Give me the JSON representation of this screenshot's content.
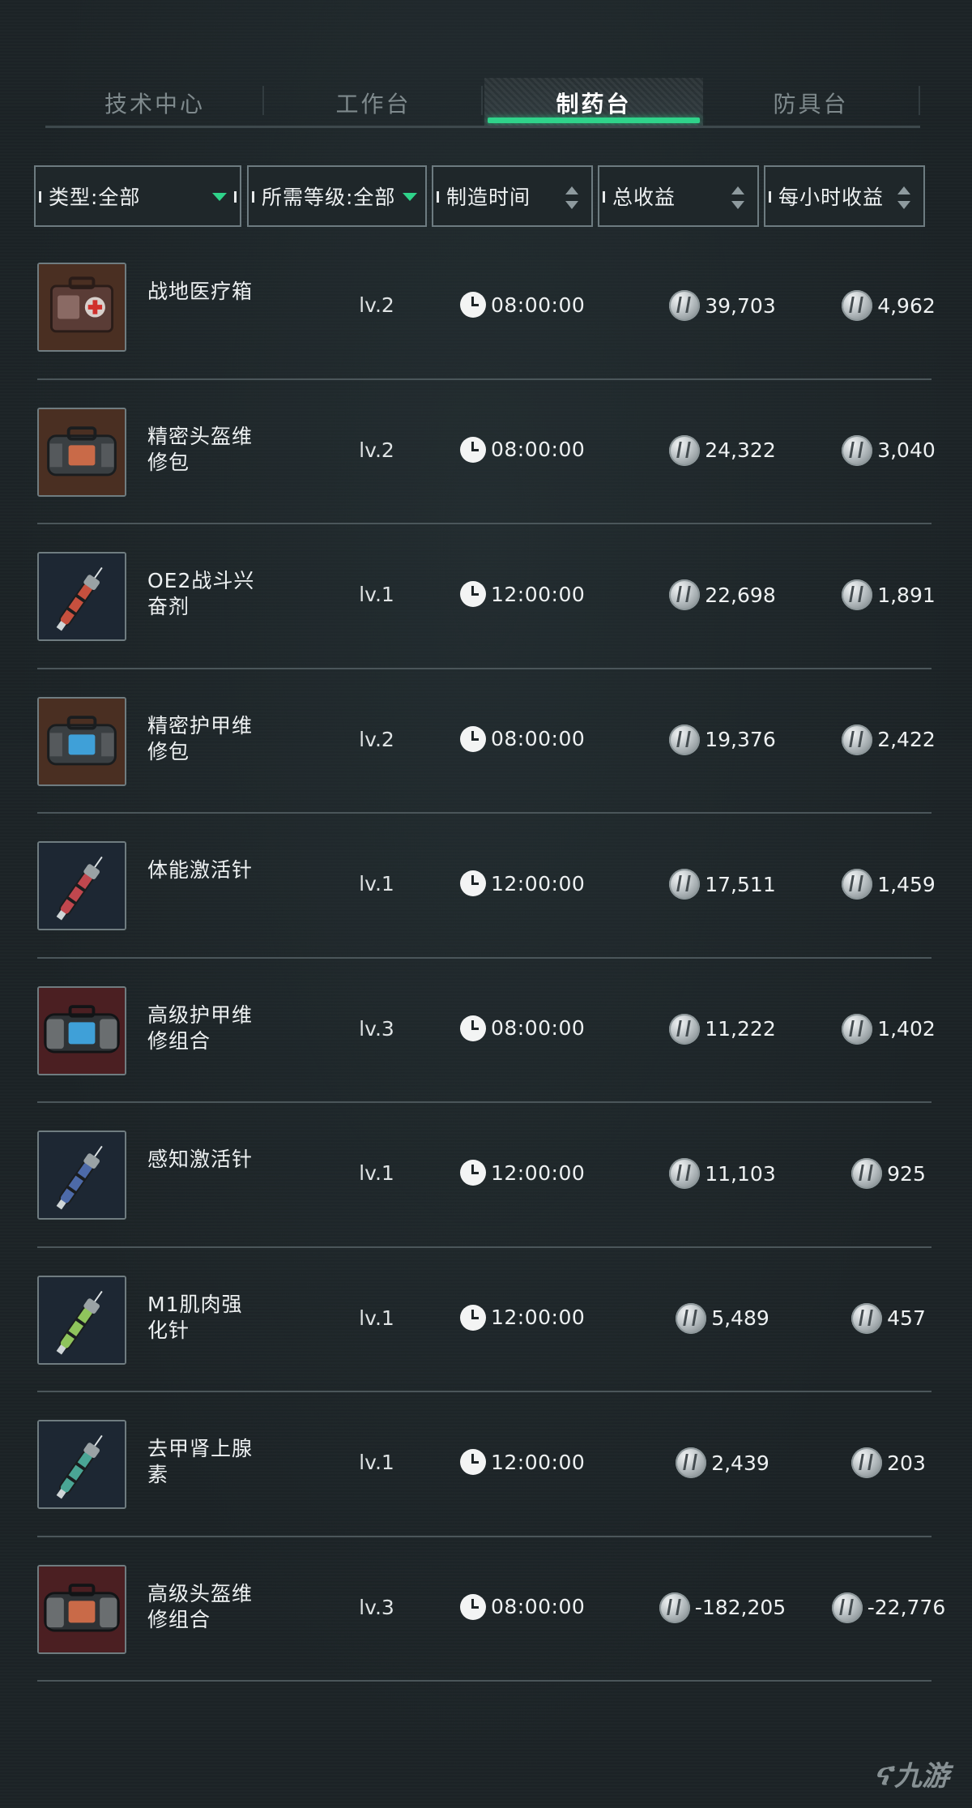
{
  "tabs": [
    {
      "label": "技术中心",
      "active": false
    },
    {
      "label": "工作台",
      "active": false
    },
    {
      "label": "制药台",
      "active": true
    },
    {
      "label": "防具台",
      "active": false
    }
  ],
  "filters": {
    "type": "类型:全部",
    "level": "所需等级:全部",
    "time": "制造时间",
    "total": "总收益",
    "hourly": "每小时收益"
  },
  "items": [
    {
      "name": "战地医疗箱",
      "level": "lv.2",
      "time": "08:00:00",
      "total": "39,703",
      "hourly": "4,962",
      "icon": "medical-case-icon"
    },
    {
      "name": "精密头盔维修包",
      "level": "lv.2",
      "time": "08:00:00",
      "total": "24,322",
      "hourly": "3,040",
      "icon": "repair-bag-icon"
    },
    {
      "name": "OE2战斗兴奋剂",
      "level": "lv.1",
      "time": "12:00:00",
      "total": "22,698",
      "hourly": "1,891",
      "icon": "injector-icon"
    },
    {
      "name": "精密护甲维修包",
      "level": "lv.2",
      "time": "08:00:00",
      "total": "19,376",
      "hourly": "2,422",
      "icon": "repair-bag-icon"
    },
    {
      "name": "体能激活针",
      "level": "lv.1",
      "time": "12:00:00",
      "total": "17,511",
      "hourly": "1,459",
      "icon": "injector-icon"
    },
    {
      "name": "高级护甲维修组合",
      "level": "lv.3",
      "time": "08:00:00",
      "total": "11,222",
      "hourly": "1,402",
      "icon": "repair-kit-icon"
    },
    {
      "name": "感知激活针",
      "level": "lv.1",
      "time": "12:00:00",
      "total": "11,103",
      "hourly": "925",
      "icon": "injector-icon"
    },
    {
      "name": "M1肌肉强化针",
      "level": "lv.1",
      "time": "12:00:00",
      "total": "5,489",
      "hourly": "457",
      "icon": "injector-icon"
    },
    {
      "name": "去甲肾上腺素",
      "level": "lv.1",
      "time": "12:00:00",
      "total": "2,439",
      "hourly": "203",
      "icon": "injector-icon"
    },
    {
      "name": "高级头盔维修组合",
      "level": "lv.3",
      "time": "08:00:00",
      "total": "-182,205",
      "hourly": "-22,776",
      "icon": "repair-kit-icon"
    }
  ],
  "watermark": "九游",
  "colors": {
    "accent": "#2fd38a",
    "background": "#1c2326",
    "thumb_bg_brown": "#4a2f22",
    "thumb_bg_navy": "#1d2733",
    "thumb_bg_red": "#4b1f22"
  }
}
